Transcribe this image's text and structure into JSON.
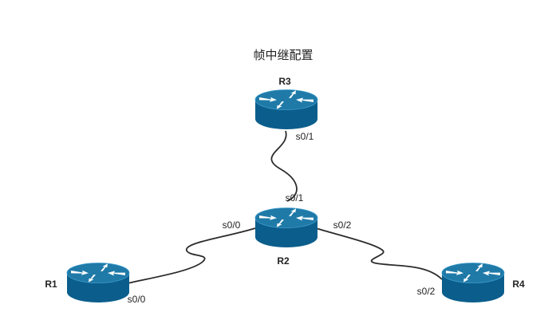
{
  "title": "帧中继配置",
  "colors": {
    "router_top": "#1f7aa8",
    "router_side": "#0b5e8c",
    "router_rim": "#3f9ccb",
    "arrow": "#ffffff",
    "link": "#2b2b2b"
  },
  "icon": "router-icon",
  "routers": {
    "r1": {
      "name": "R1"
    },
    "r2": {
      "name": "R2"
    },
    "r3": {
      "name": "R3"
    },
    "r4": {
      "name": "R4"
    }
  },
  "links": {
    "r3_r2": {
      "a": "s0/1",
      "b": "s0/1"
    },
    "r2_r1": {
      "a": "s0/0",
      "b": "s0/0"
    },
    "r2_r4": {
      "a": "s0/2",
      "b": "s0/2"
    }
  }
}
